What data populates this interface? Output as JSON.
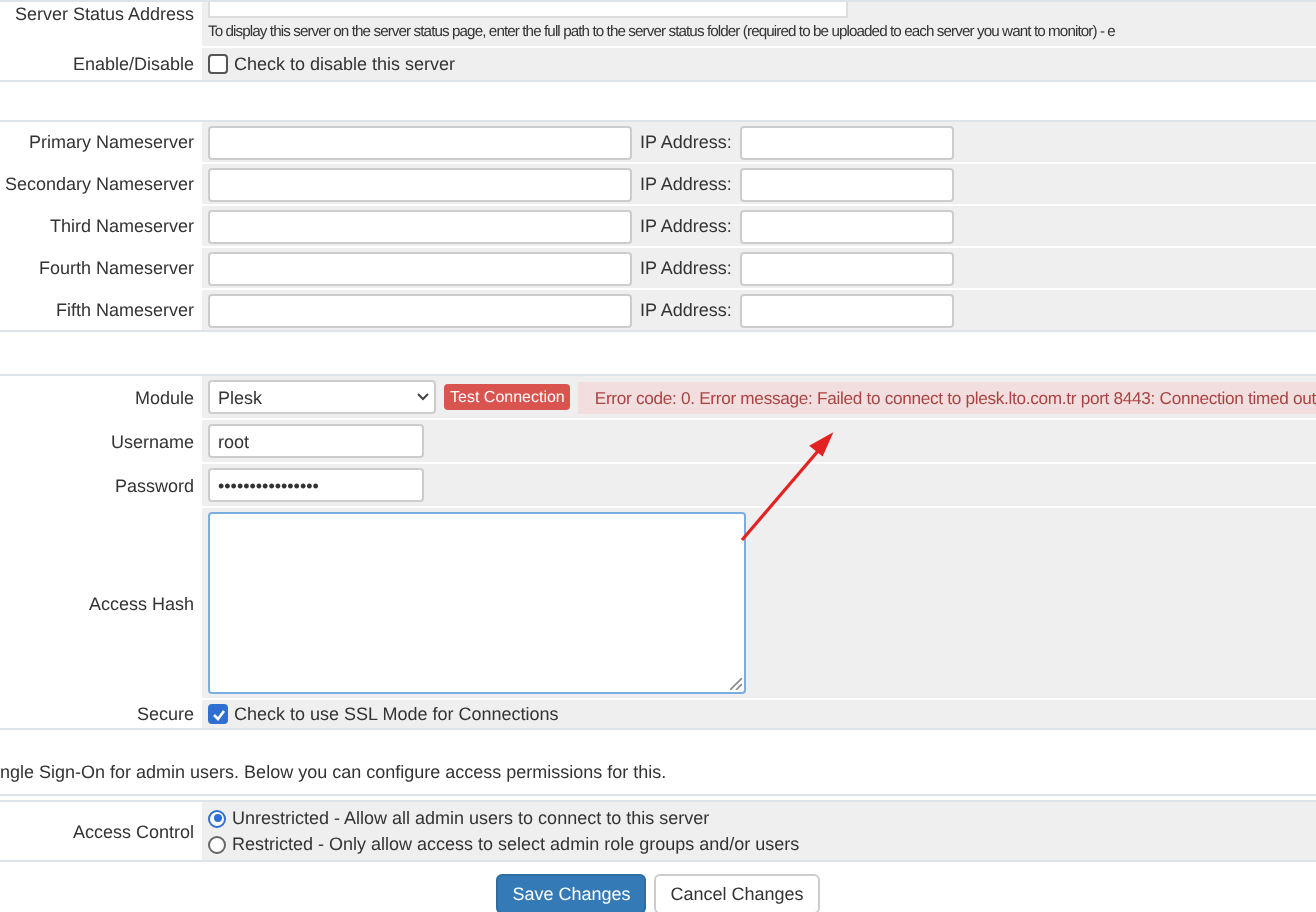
{
  "server_status": {
    "label": "Server Status Address",
    "help": "To display this server on the server status page, enter the full path to the server status folder (required to be uploaded to each server you want to monitor) - e"
  },
  "enable_disable": {
    "label": "Enable/Disable",
    "checkbox_label": "Check to disable this server",
    "checked": false
  },
  "nameservers": [
    {
      "label": "Primary Nameserver",
      "ip_label": "IP Address:"
    },
    {
      "label": "Secondary Nameserver",
      "ip_label": "IP Address:"
    },
    {
      "label": "Third Nameserver",
      "ip_label": "IP Address:"
    },
    {
      "label": "Fourth Nameserver",
      "ip_label": "IP Address:"
    },
    {
      "label": "Fifth Nameserver",
      "ip_label": "IP Address:"
    }
  ],
  "module": {
    "label": "Module",
    "value": "Plesk",
    "test_button": "Test Connection",
    "error": "Error code: 0. Error message: Failed to connect to plesk.lto.com.tr port 8443: Connection timed out"
  },
  "username": {
    "label": "Username",
    "value": "root"
  },
  "password": {
    "label": "Password",
    "value": "••••••••••••••••"
  },
  "access_hash": {
    "label": "Access Hash"
  },
  "secure": {
    "label": "Secure",
    "checkbox_label": "Check to use SSL Mode for Connections",
    "checked": true
  },
  "sso_note": "ngle Sign-On for admin users. Below you can configure access permissions for this.",
  "access_control": {
    "label": "Access Control",
    "options": [
      {
        "label": "Unrestricted - Allow all admin users to connect to this server",
        "selected": true
      },
      {
        "label": "Restricted - Only allow access to select admin role groups and/or users",
        "selected": false
      }
    ]
  },
  "buttons": [
    {
      "label": "Save Changes",
      "kind": "primary"
    },
    {
      "label": "Cancel Changes",
      "kind": "default"
    }
  ]
}
